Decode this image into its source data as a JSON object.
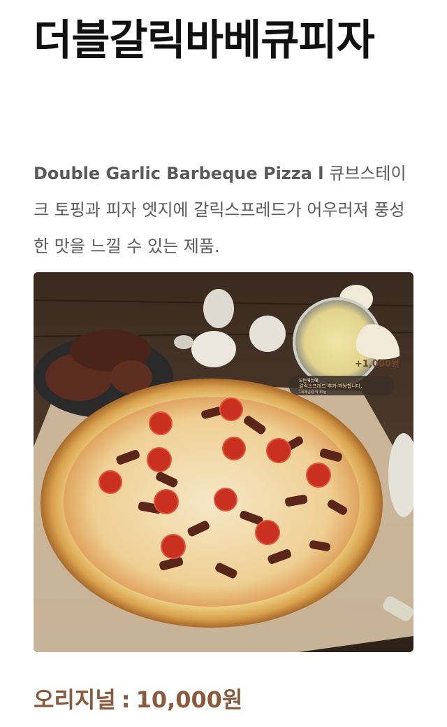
{
  "product": {
    "title": "더블갈릭바베큐피자",
    "desc_en": "Double Garlic Barbeque Pizza l",
    "desc_ko": " 큐브스테이크 토핑과 피자 엣지에 갈릭스프레드가 어우러져 풍성한 맛을 느낄 수 있는 제품.",
    "image_alt": "더블갈릭바베큐피자"
  },
  "badge": {
    "price": "+1,000원",
    "line1": "모든메뉴에",
    "line2": "갈릭스프레드 추가 가능합니다.",
    "line3": "1회제공량 약 80g"
  },
  "pricing": {
    "label": "오리지널",
    "separator": ":",
    "price": "10,000원"
  },
  "colors": {
    "price_text": "#8a5a3c",
    "title_text": "#111111",
    "desc_text": "#5a5a5a"
  }
}
